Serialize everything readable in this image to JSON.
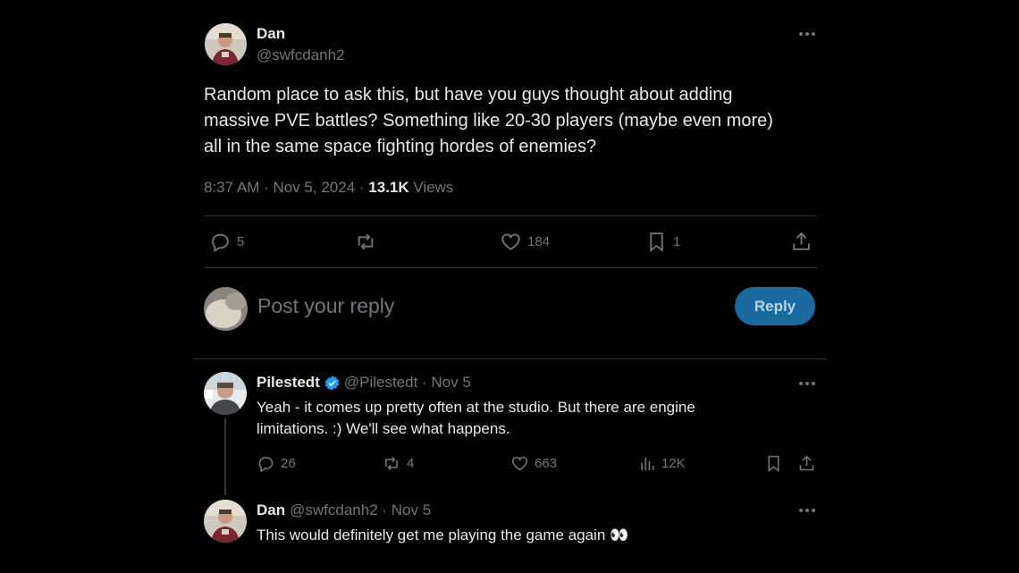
{
  "main_tweet": {
    "author_name": "Dan",
    "handle": "@swfcdanh2",
    "text_lines": [
      "Random place to ask this, but have you guys thought about adding",
      "massive PVE battles? Something like 20-30 players (maybe even more)",
      "all in the same space fighting hordes of enemies?"
    ],
    "time": "8:37 AM · Nov 5, 2024 ·",
    "views_count": "13.1K",
    "views_label": "Views",
    "stats": {
      "replies": "5",
      "likes": "184",
      "bookmarks": "1"
    }
  },
  "composer": {
    "placeholder": "Post your reply",
    "reply_label": "Reply"
  },
  "reply_1": {
    "author_name": "Pilestedt",
    "handle_date": "@Pilestedt · Nov 5",
    "text_lines": [
      "Yeah - it comes up pretty often at the studio. But there are engine",
      "limitations. :) We'll see what happens."
    ],
    "stats": {
      "replies": "26",
      "reposts": "4",
      "likes": "663",
      "views": "12K"
    }
  },
  "reply_2": {
    "author_name": "Dan",
    "handle_date": "@swfcdanh2 · Nov 5",
    "text": "This would definitely get me playing the game again 👀"
  },
  "colors": {
    "accent": "#1d9bf0",
    "verified": "#1d9bf0",
    "reply_button": "#1a6aa0",
    "divider": "#2f3336",
    "muted": "#71767b"
  }
}
